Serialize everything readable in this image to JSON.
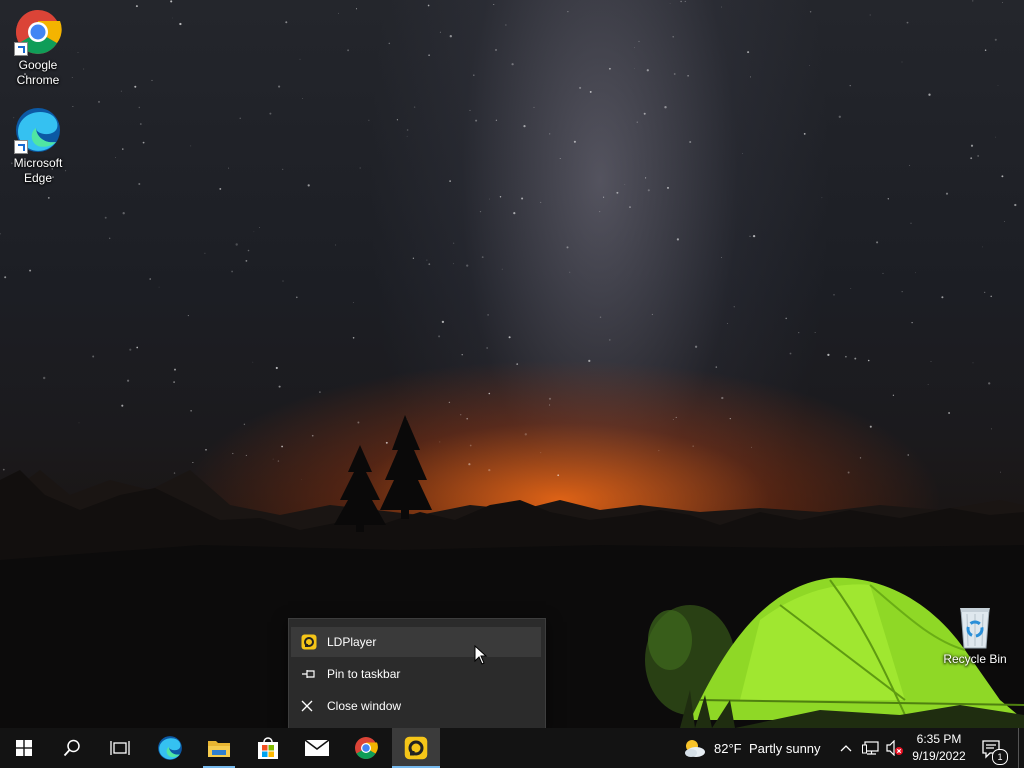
{
  "desktop": {
    "icons": [
      {
        "label": "Google\nChrome",
        "name": "google-chrome-shortcut"
      },
      {
        "label": "Microsoft\nEdge",
        "name": "microsoft-edge-shortcut"
      },
      {
        "label": "Recycle Bin",
        "name": "recycle-bin"
      }
    ]
  },
  "jumplist": {
    "app_title": "LDPlayer",
    "pin_label": "Pin to taskbar",
    "close_label": "Close window"
  },
  "taskbar": {
    "apps": [
      {
        "name": "start",
        "icon": "windows-logo-icon"
      },
      {
        "name": "search",
        "icon": "search-icon"
      },
      {
        "name": "task-view",
        "icon": "task-view-icon"
      },
      {
        "name": "edge",
        "icon": "edge-icon"
      },
      {
        "name": "file-explorer",
        "icon": "folder-icon"
      },
      {
        "name": "microsoft-store",
        "icon": "store-icon"
      },
      {
        "name": "mail",
        "icon": "mail-icon"
      },
      {
        "name": "chrome",
        "icon": "chrome-icon"
      },
      {
        "name": "ldplayer",
        "icon": "ldplayer-icon"
      }
    ],
    "weather": {
      "temp": "82°F",
      "condition": "Partly sunny"
    },
    "clock": {
      "time": "6:35 PM",
      "date": "9/19/2022"
    },
    "notifications_count": "1"
  },
  "colors": {
    "taskbar_bg": "#131313",
    "accent_indicator": "#76b9ed",
    "menu_bg": "#2b2b2b",
    "tent_green": "#8fd826"
  }
}
